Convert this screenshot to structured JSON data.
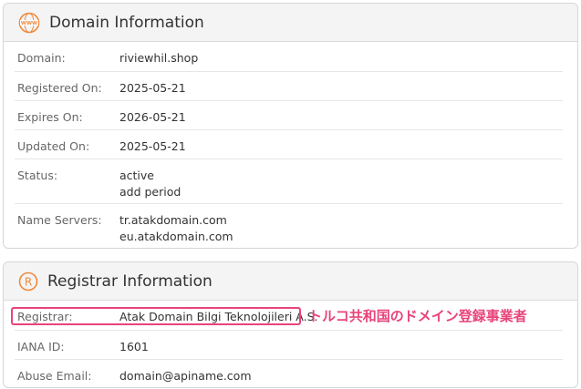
{
  "domain_info": {
    "title": "Domain Information",
    "icon": "www-globe-icon",
    "rows": [
      {
        "label": "Domain:",
        "value": "riviewhil.shop"
      },
      {
        "label": "Registered On:",
        "value": "2025-05-21"
      },
      {
        "label": "Expires On:",
        "value": "2026-05-21"
      },
      {
        "label": "Updated On:",
        "value": "2025-05-21"
      },
      {
        "label": "Status:",
        "values": [
          "active",
          "add period"
        ]
      },
      {
        "label": "Name Servers:",
        "values": [
          "tr.atakdomain.com",
          "eu.atakdomain.com"
        ]
      }
    ]
  },
  "registrar_info": {
    "title": "Registrar Information",
    "icon": "registered-mark-icon",
    "rows": [
      {
        "label": "Registrar:",
        "value": "Atak Domain Bilgi Teknolojileri A.S."
      },
      {
        "label": "IANA ID:",
        "value": "1601"
      },
      {
        "label": "Abuse Email:",
        "value": "domain@apiname.com"
      }
    ],
    "annotation": "トルコ共和国のドメイン登録事業者"
  },
  "colors": {
    "accent": "#f0883a",
    "highlight": "#e8447a"
  }
}
